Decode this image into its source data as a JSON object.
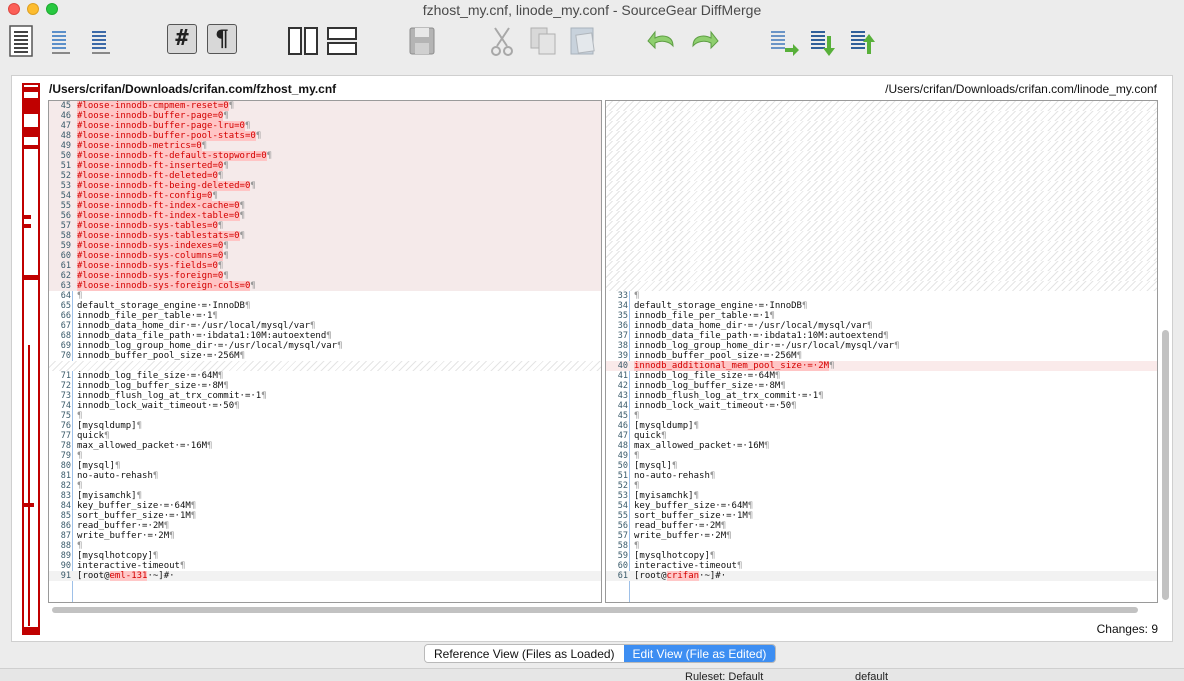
{
  "window": {
    "title": "fzhost_my.cnf, linode_my.conf - SourceGear DiffMerge"
  },
  "toolbar": {
    "icons": [
      "document-icon",
      "document-lines-icon",
      "document-lines-small-icon",
      "line-numbers-icon",
      "pilcrow-icon",
      "split-vertical-icon",
      "split-horizontal-icon",
      "save-icon",
      "cut-icon",
      "copy-icon",
      "paste-icon",
      "undo-icon",
      "redo-icon",
      "previous-change-icon",
      "next-change-icon",
      "apply-change-icon"
    ],
    "hash_glyph": "#",
    "pilcrow_glyph": "¶"
  },
  "colors": {
    "deleted": "#d40000",
    "highlight": "#ffc5c5",
    "accent": "#3d8ef2",
    "overview": "#c00000"
  },
  "left": {
    "path": "/Users/crifan/Downloads/crifan.com/fzhost_my.cnf",
    "lines": [
      {
        "n": "45",
        "t": "#loose-innodb-cmpmem-reset=0",
        "k": "del"
      },
      {
        "n": "46",
        "t": "#loose-innodb-buffer-page=0",
        "k": "del"
      },
      {
        "n": "47",
        "t": "#loose-innodb-buffer-page-lru=0",
        "k": "del"
      },
      {
        "n": "48",
        "t": "#loose-innodb-buffer-pool-stats=0",
        "k": "del"
      },
      {
        "n": "49",
        "t": "#loose-innodb-metrics=0",
        "k": "del"
      },
      {
        "n": "50",
        "t": "#loose-innodb-ft-default-stopword=0",
        "k": "del"
      },
      {
        "n": "51",
        "t": "#loose-innodb-ft-inserted=0",
        "k": "del"
      },
      {
        "n": "52",
        "t": "#loose-innodb-ft-deleted=0",
        "k": "del"
      },
      {
        "n": "53",
        "t": "#loose-innodb-ft-being-deleted=0",
        "k": "del"
      },
      {
        "n": "54",
        "t": "#loose-innodb-ft-config=0",
        "k": "del"
      },
      {
        "n": "55",
        "t": "#loose-innodb-ft-index-cache=0",
        "k": "del"
      },
      {
        "n": "56",
        "t": "#loose-innodb-ft-index-table=0",
        "k": "del"
      },
      {
        "n": "57",
        "t": "#loose-innodb-sys-tables=0",
        "k": "del"
      },
      {
        "n": "58",
        "t": "#loose-innodb-sys-tablestats=0",
        "k": "del"
      },
      {
        "n": "59",
        "t": "#loose-innodb-sys-indexes=0",
        "k": "del"
      },
      {
        "n": "60",
        "t": "#loose-innodb-sys-columns=0",
        "k": "del"
      },
      {
        "n": "61",
        "t": "#loose-innodb-sys-fields=0",
        "k": "del"
      },
      {
        "n": "62",
        "t": "#loose-innodb-sys-foreign=0",
        "k": "del"
      },
      {
        "n": "63",
        "t": "#loose-innodb-sys-foreign-cols=0",
        "k": "del"
      },
      {
        "n": "64",
        "t": "",
        "k": "eq"
      },
      {
        "n": "65",
        "t": "default_storage_engine·=·InnoDB",
        "k": "eq"
      },
      {
        "n": "66",
        "t": "innodb_file_per_table·=·1",
        "k": "eq"
      },
      {
        "n": "67",
        "t": "innodb_data_home_dir·=·/usr/local/mysql/var",
        "k": "eq"
      },
      {
        "n": "68",
        "t": "innodb_data_file_path·=·ibdata1:10M:autoextend",
        "k": "eq"
      },
      {
        "n": "69",
        "t": "innodb_log_group_home_dir·=·/usr/local/mysql/var",
        "k": "eq"
      },
      {
        "n": "70",
        "t": "innodb_buffer_pool_size·=·256M",
        "k": "eq"
      },
      {
        "n": "",
        "t": "",
        "k": "hatch"
      },
      {
        "n": "71",
        "t": "innodb_log_file_size·=·64M",
        "k": "eq"
      },
      {
        "n": "72",
        "t": "innodb_log_buffer_size·=·8M",
        "k": "eq"
      },
      {
        "n": "73",
        "t": "innodb_flush_log_at_trx_commit·=·1",
        "k": "eq"
      },
      {
        "n": "74",
        "t": "innodb_lock_wait_timeout·=·50",
        "k": "eq"
      },
      {
        "n": "75",
        "t": "",
        "k": "eq"
      },
      {
        "n": "76",
        "t": "[mysqldump]",
        "k": "eq"
      },
      {
        "n": "77",
        "t": "quick",
        "k": "eq"
      },
      {
        "n": "78",
        "t": "max_allowed_packet·=·16M",
        "k": "eq"
      },
      {
        "n": "79",
        "t": "",
        "k": "eq"
      },
      {
        "n": "80",
        "t": "[mysql]",
        "k": "eq"
      },
      {
        "n": "81",
        "t": "no-auto-rehash",
        "k": "eq"
      },
      {
        "n": "82",
        "t": "",
        "k": "eq"
      },
      {
        "n": "83",
        "t": "[myisamchk]",
        "k": "eq"
      },
      {
        "n": "84",
        "t": "key_buffer_size·=·64M",
        "k": "eq"
      },
      {
        "n": "85",
        "t": "sort_buffer_size·=·1M",
        "k": "eq"
      },
      {
        "n": "86",
        "t": "read_buffer·=·2M",
        "k": "eq"
      },
      {
        "n": "87",
        "t": "write_buffer·=·2M",
        "k": "eq"
      },
      {
        "n": "88",
        "t": "",
        "k": "eq"
      },
      {
        "n": "89",
        "t": "[mysqlhotcopy]",
        "k": "eq"
      },
      {
        "n": "90",
        "t": "interactive-timeout",
        "k": "eq"
      },
      {
        "n": "91",
        "t": "[root@",
        "hl": "eml-131",
        "post": "·~]#·",
        "k": "cur"
      }
    ]
  },
  "right": {
    "path": "/Users/crifan/Downloads/crifan.com/linode_my.conf",
    "lines": [
      {
        "n": "",
        "t": "",
        "k": "hatch"
      },
      {
        "n": "",
        "t": "",
        "k": "hatch"
      },
      {
        "n": "",
        "t": "",
        "k": "hatch"
      },
      {
        "n": "",
        "t": "",
        "k": "hatch"
      },
      {
        "n": "",
        "t": "",
        "k": "hatch"
      },
      {
        "n": "",
        "t": "",
        "k": "hatch"
      },
      {
        "n": "",
        "t": "",
        "k": "hatch"
      },
      {
        "n": "",
        "t": "",
        "k": "hatch"
      },
      {
        "n": "",
        "t": "",
        "k": "hatch"
      },
      {
        "n": "",
        "t": "",
        "k": "hatch"
      },
      {
        "n": "",
        "t": "",
        "k": "hatch"
      },
      {
        "n": "",
        "t": "",
        "k": "hatch"
      },
      {
        "n": "",
        "t": "",
        "k": "hatch"
      },
      {
        "n": "",
        "t": "",
        "k": "hatch"
      },
      {
        "n": "",
        "t": "",
        "k": "hatch"
      },
      {
        "n": "",
        "t": "",
        "k": "hatch"
      },
      {
        "n": "",
        "t": "",
        "k": "hatch"
      },
      {
        "n": "",
        "t": "",
        "k": "hatch"
      },
      {
        "n": "",
        "t": "",
        "k": "hatch"
      },
      {
        "n": "33",
        "t": "",
        "k": "eq"
      },
      {
        "n": "34",
        "t": "default_storage_engine·=·InnoDB",
        "k": "eq"
      },
      {
        "n": "35",
        "t": "innodb_file_per_table·=·1",
        "k": "eq"
      },
      {
        "n": "36",
        "t": "innodb_data_home_dir·=·/usr/local/mysql/var",
        "k": "eq"
      },
      {
        "n": "37",
        "t": "innodb_data_file_path·=·ibdata1:10M:autoextend",
        "k": "eq"
      },
      {
        "n": "38",
        "t": "innodb_log_group_home_dir·=·/usr/local/mysql/var",
        "k": "eq"
      },
      {
        "n": "39",
        "t": "innodb_buffer_pool_size·=·256M",
        "k": "eq"
      },
      {
        "n": "40",
        "t": "innodb_additional_mem_pool_size·=·2M",
        "k": "chg"
      },
      {
        "n": "41",
        "t": "innodb_log_file_size·=·64M",
        "k": "eq"
      },
      {
        "n": "42",
        "t": "innodb_log_buffer_size·=·8M",
        "k": "eq"
      },
      {
        "n": "43",
        "t": "innodb_flush_log_at_trx_commit·=·1",
        "k": "eq"
      },
      {
        "n": "44",
        "t": "innodb_lock_wait_timeout·=·50",
        "k": "eq"
      },
      {
        "n": "45",
        "t": "",
        "k": "eq"
      },
      {
        "n": "46",
        "t": "[mysqldump]",
        "k": "eq"
      },
      {
        "n": "47",
        "t": "quick",
        "k": "eq"
      },
      {
        "n": "48",
        "t": "max_allowed_packet·=·16M",
        "k": "eq"
      },
      {
        "n": "49",
        "t": "",
        "k": "eq"
      },
      {
        "n": "50",
        "t": "[mysql]",
        "k": "eq"
      },
      {
        "n": "51",
        "t": "no-auto-rehash",
        "k": "eq"
      },
      {
        "n": "52",
        "t": "",
        "k": "eq"
      },
      {
        "n": "53",
        "t": "[myisamchk]",
        "k": "eq"
      },
      {
        "n": "54",
        "t": "key_buffer_size·=·64M",
        "k": "eq"
      },
      {
        "n": "55",
        "t": "sort_buffer_size·=·1M",
        "k": "eq"
      },
      {
        "n": "56",
        "t": "read_buffer·=·2M",
        "k": "eq"
      },
      {
        "n": "57",
        "t": "write_buffer·=·2M",
        "k": "eq"
      },
      {
        "n": "58",
        "t": "",
        "k": "eq"
      },
      {
        "n": "59",
        "t": "[mysqlhotcopy]",
        "k": "eq"
      },
      {
        "n": "60",
        "t": "interactive-timeout",
        "k": "eq"
      },
      {
        "n": "61",
        "t": "[root@",
        "hl": "crifan",
        "post": "·~]#·",
        "k": "cur"
      }
    ]
  },
  "status": {
    "changes": "Changes: 9",
    "ruleset": "Ruleset:  Default",
    "encoding": "default"
  },
  "view": {
    "reference_label": "Reference View (Files as Loaded)",
    "edit_label": "Edit View (File as Edited)"
  }
}
